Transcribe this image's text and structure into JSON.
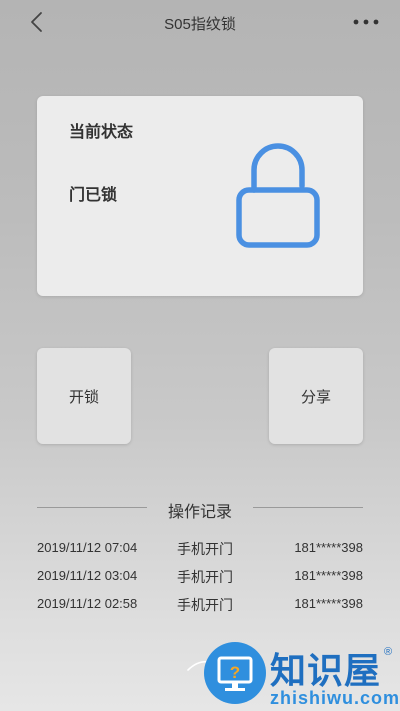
{
  "header": {
    "title": "S05指纹锁"
  },
  "status_card": {
    "label": "当前状态",
    "value": "门已锁"
  },
  "actions": {
    "unlock_label": "开锁",
    "share_label": "分享"
  },
  "records": {
    "title": "操作记录",
    "rows": [
      {
        "time": "2019/11/12 07:04",
        "method": "手机开门",
        "phone": "181*****398"
      },
      {
        "time": "2019/11/12 03:04",
        "method": "手机开门",
        "phone": "181*****398"
      },
      {
        "time": "2019/11/12 02:58",
        "method": "手机开门",
        "phone": "181*****398"
      }
    ]
  },
  "watermark": {
    "name": "知识屋",
    "registered": "®",
    "url": "zhishiwu.com"
  },
  "icons": {
    "back": "chevron-left-icon",
    "more": "more-horizontal-icon",
    "lock": "lock-icon",
    "watermark_logo": "monitor-question-icon"
  },
  "colors": {
    "lock_accent": "#4a90e2",
    "watermark_blue": "#2f8fde"
  }
}
